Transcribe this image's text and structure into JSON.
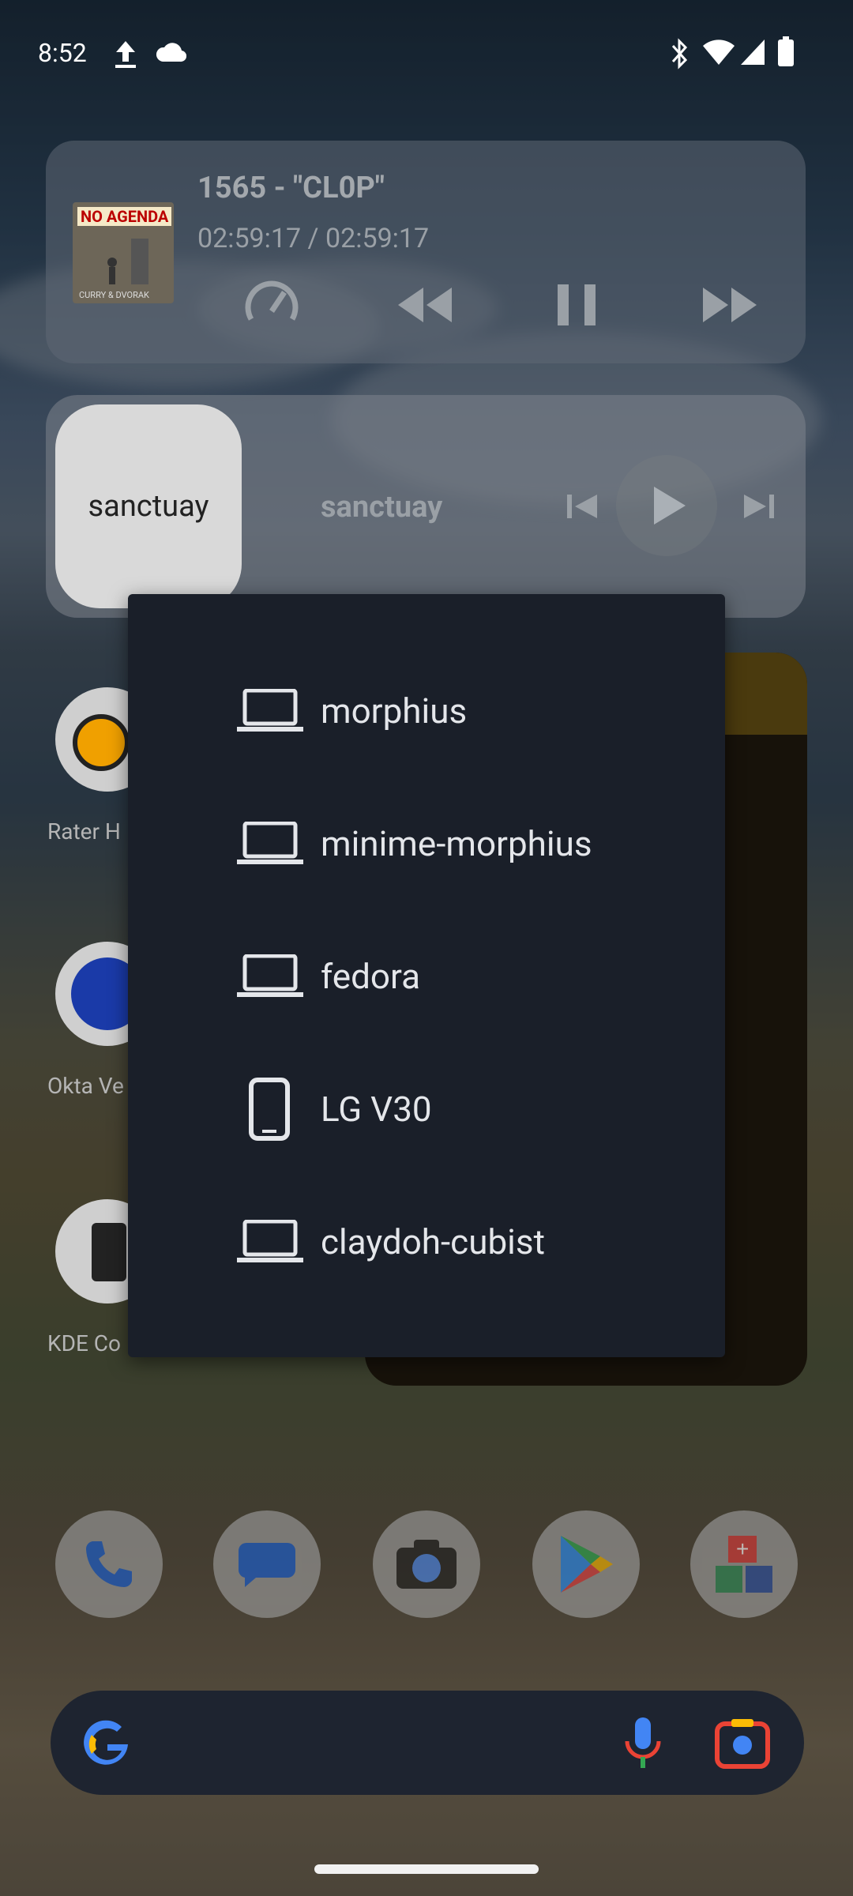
{
  "status_bar": {
    "time": "8:52"
  },
  "media_player": {
    "album_art_text": "NO AGENDA",
    "album_art_subtext": "CURRY & DVORAK",
    "episode_title": "1565 - \"CL0P\"",
    "progress": "02:59:17 / 02:59:17"
  },
  "music_widget": {
    "tile_label": "sanctuay",
    "track_label": "sanctuay"
  },
  "apps_partial": {
    "rater_label": "Rater H",
    "okta_label": "Okta Ve",
    "kde_label": "KDE Co"
  },
  "device_menu": {
    "items": [
      {
        "label": "morphius",
        "icon": "laptop-icon"
      },
      {
        "label": "minime-morphius",
        "icon": "laptop-icon"
      },
      {
        "label": "fedora",
        "icon": "laptop-icon"
      },
      {
        "label": "LG V30",
        "icon": "phone-icon"
      },
      {
        "label": "claydoh-cubist",
        "icon": "laptop-icon"
      }
    ]
  },
  "dock": {
    "apps": [
      "phone-icon",
      "messages-icon",
      "camera-icon",
      "play-store-icon",
      "calculator-icon"
    ]
  },
  "search_bar": {
    "logo": "google-icon",
    "mic": "mic-icon",
    "lens": "lens-icon"
  }
}
